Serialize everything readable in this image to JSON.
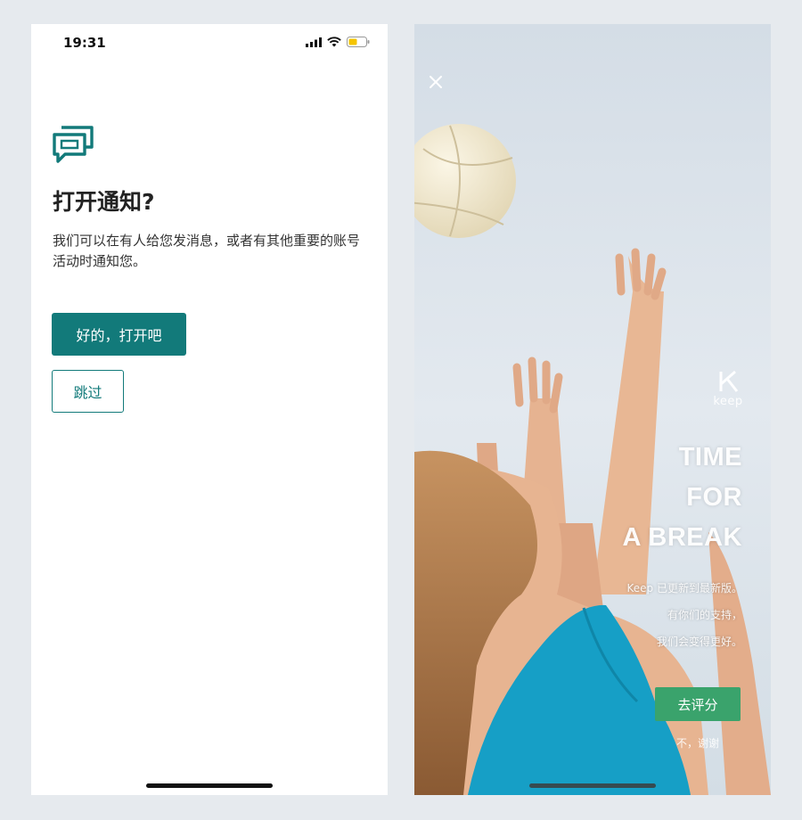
{
  "notification_screen": {
    "status_bar": {
      "time": "19:31"
    },
    "title": "打开通知?",
    "description": "我们可以在有人给您发消息，或者有其他重要的账号活动时通知您。",
    "primary_button": "好的，打开吧",
    "secondary_button": "跳过",
    "accent_color": "#127a7a",
    "icon": "chat-bubbles-icon"
  },
  "keep_screen": {
    "brand": "keep",
    "headline_lines": [
      "TIME",
      "FOR",
      "A BREAK"
    ],
    "message_lines": [
      "Keep 已更新到最新版。",
      "有你们的支持，",
      "我们会变得更好。"
    ],
    "rate_button": "去评分",
    "decline_link": "不，谢谢",
    "accent_color": "#3aa36c",
    "close_icon": "close-icon"
  }
}
